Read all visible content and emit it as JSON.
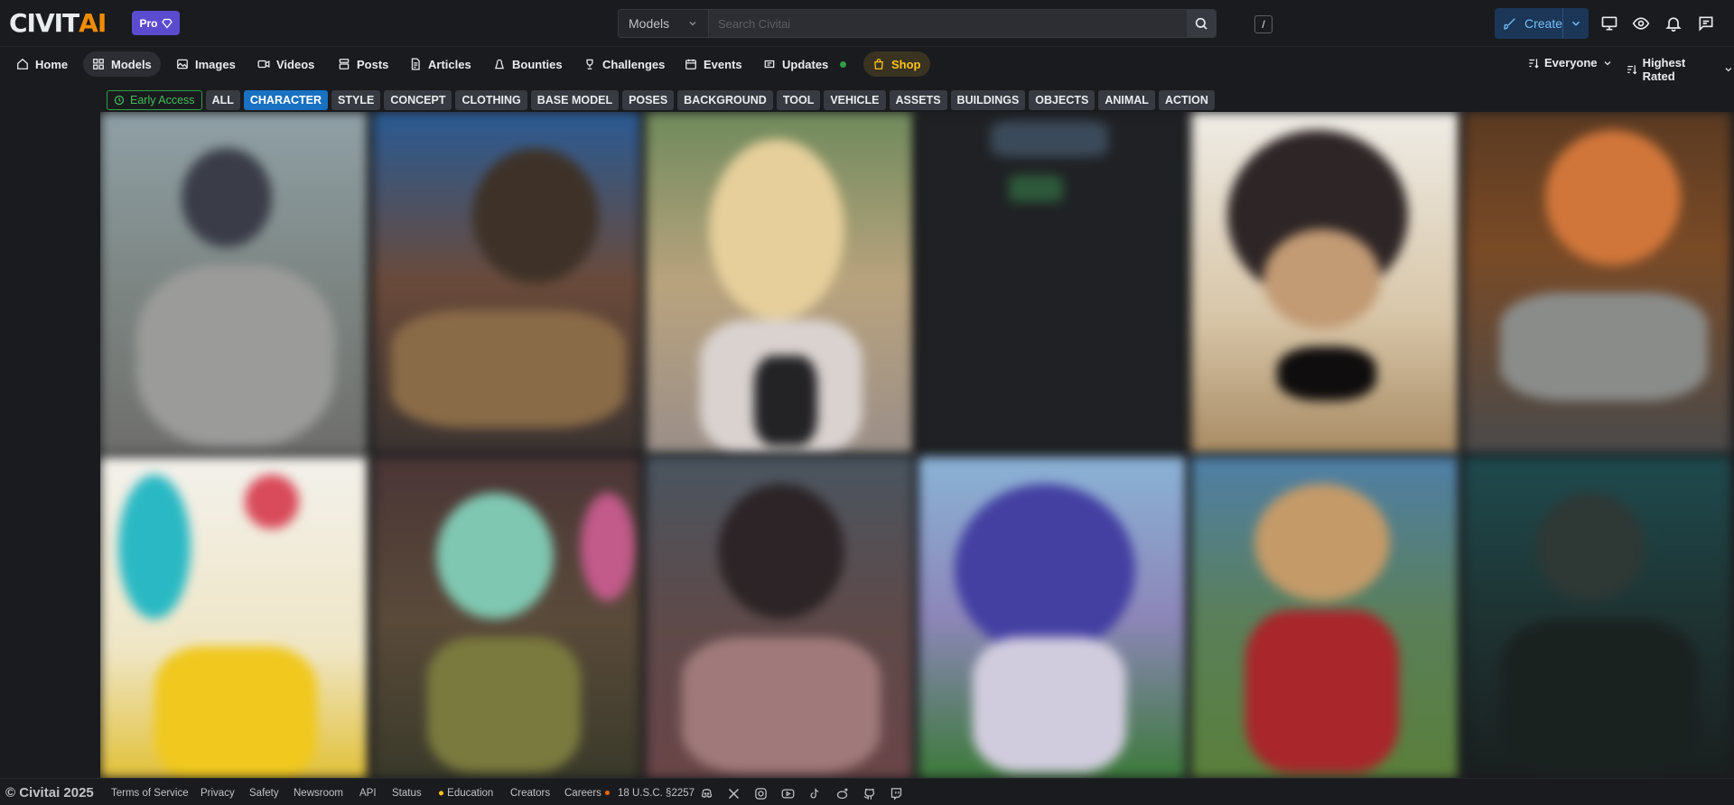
{
  "brand": {
    "logo_civit": "CIVIT",
    "logo_ai": "AI",
    "pro_label": "Pro"
  },
  "search": {
    "scope": "Models",
    "placeholder": "Search Civitai",
    "shortcut": "/"
  },
  "header": {
    "create_label": "Create"
  },
  "nav": {
    "items": [
      {
        "label": "Home",
        "icon": "home-icon"
      },
      {
        "label": "Models",
        "icon": "grid-icon",
        "active": true
      },
      {
        "label": "Images",
        "icon": "image-icon"
      },
      {
        "label": "Videos",
        "icon": "video-icon"
      },
      {
        "label": "Posts",
        "icon": "posts-icon"
      },
      {
        "label": "Articles",
        "icon": "article-icon"
      },
      {
        "label": "Bounties",
        "icon": "bounty-icon"
      },
      {
        "label": "Challenges",
        "icon": "trophy-icon"
      },
      {
        "label": "Events",
        "icon": "calendar-icon"
      },
      {
        "label": "Updates",
        "icon": "updates-icon"
      },
      {
        "label": "Shop",
        "icon": "shop-icon"
      }
    ],
    "filter_label": "Everyone",
    "sort_label": "Highest Rated"
  },
  "tags": {
    "early_access": "Early Access",
    "items": [
      "ALL",
      "CHARACTER",
      "STYLE",
      "CONCEPT",
      "CLOTHING",
      "BASE MODEL",
      "POSES",
      "BACKGROUND",
      "TOOL",
      "VEHICLE",
      "ASSETS",
      "BUILDINGS",
      "OBJECTS",
      "ANIMAL",
      "ACTION"
    ],
    "active": "CHARACTER"
  },
  "footer": {
    "copyright": "© Civitai 2025",
    "links": [
      "Terms of Service",
      "Privacy",
      "Safety",
      "Newsroom",
      "API",
      "Status",
      "Education",
      "Creators",
      "Careers",
      "18 U.S.C. §2257"
    ],
    "social_icons": [
      "discord-icon",
      "x-icon",
      "instagram-icon",
      "youtube-icon",
      "tiktok-icon",
      "reddit-icon",
      "github-icon",
      "twitch-icon"
    ]
  },
  "colors": {
    "accent": "#1971c2",
    "brand_orange": "#f08c00",
    "pro": "#5b4ccf",
    "shop": "#fcc419"
  }
}
